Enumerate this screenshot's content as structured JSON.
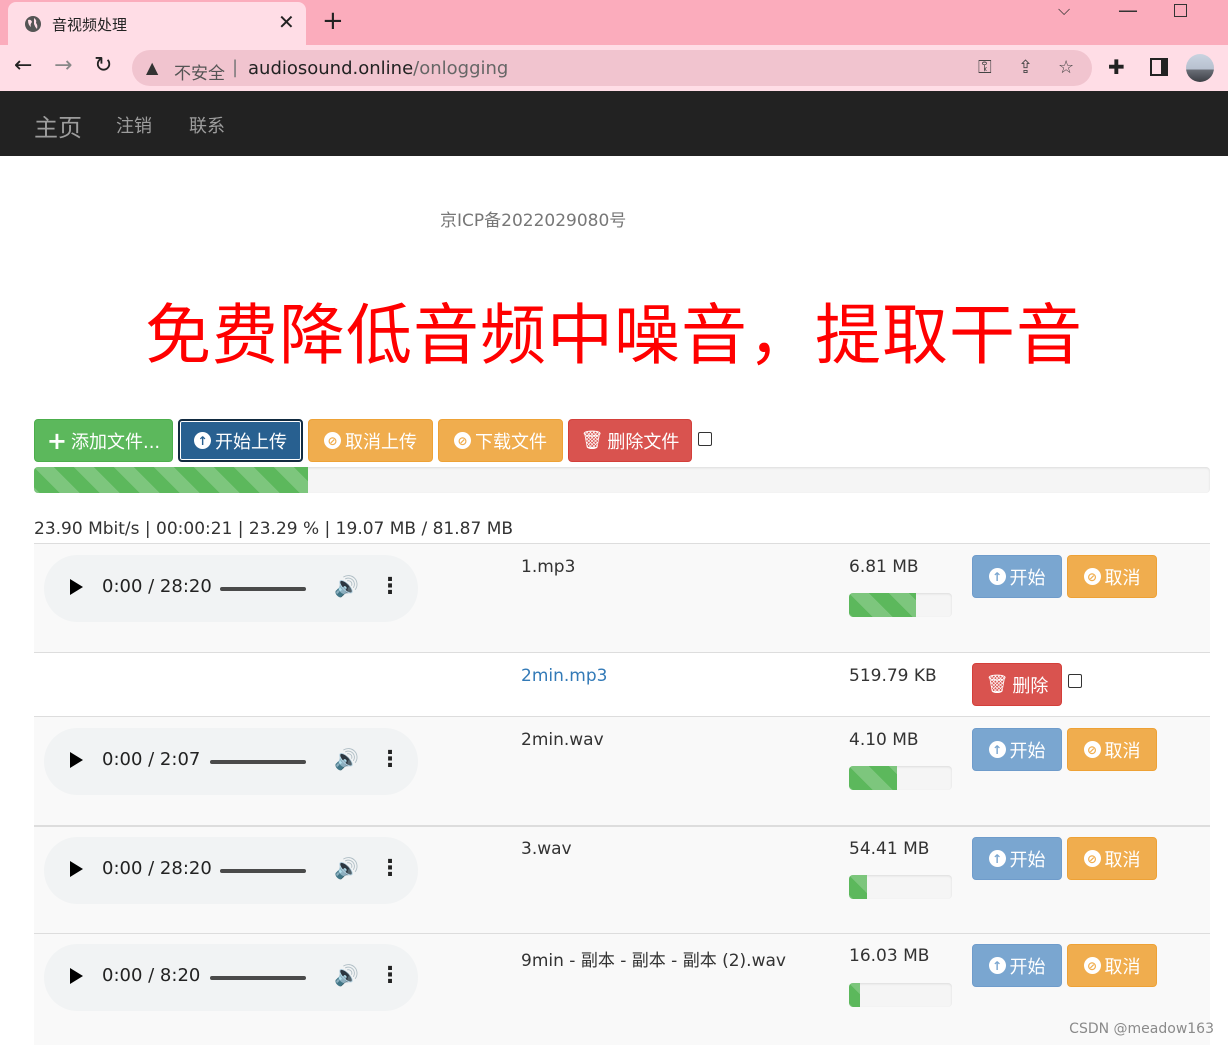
{
  "browser": {
    "tab_title": "音视频处理",
    "insecure_label": "不安全",
    "url_host": "audiosound.online",
    "url_path": "/onlogging"
  },
  "nav": {
    "brand": "主页",
    "links": [
      "注销",
      "联系"
    ]
  },
  "icp": "京ICP备2022029080号",
  "headline": "免费降低音频中噪音，提取干音",
  "toolbar": {
    "add": "添加文件...",
    "start": "开始上传",
    "cancel": "取消上传",
    "download": "下载文件",
    "delete": "删除文件"
  },
  "global_progress": 0.2329,
  "stats": "23.90 Mbit/s | 00:00:21 | 23.29 % | 19.07 MB / 81.87 MB",
  "row_buttons": {
    "start": "开始",
    "cancel": "取消",
    "delete": "删除"
  },
  "files": [
    {
      "name": "1.mp3",
      "size": "6.81 MB",
      "time": "0:00 / 28:20",
      "progress": 0.65
    },
    {
      "name": "2min.mp3",
      "size": "519.79 KB"
    },
    {
      "name": "2min.wav",
      "size": "4.10 MB",
      "time": "0:00 / 2:07",
      "progress": 0.47
    },
    {
      "name": "3.wav",
      "size": "54.41 MB",
      "time": "0:00 / 28:20",
      "progress": 0.17
    },
    {
      "name": "9min - 副本 - 副本 - 副本 (2).wav",
      "size": "16.03 MB",
      "time": "0:00 / 8:20",
      "progress": 0.11
    }
  ],
  "watermark": "CSDN @meadow163",
  "colors": {
    "success": "#5cb85c",
    "primary": "#286090",
    "warning": "#f0ad4e",
    "danger": "#d9534f",
    "headline": "#ff0000"
  }
}
